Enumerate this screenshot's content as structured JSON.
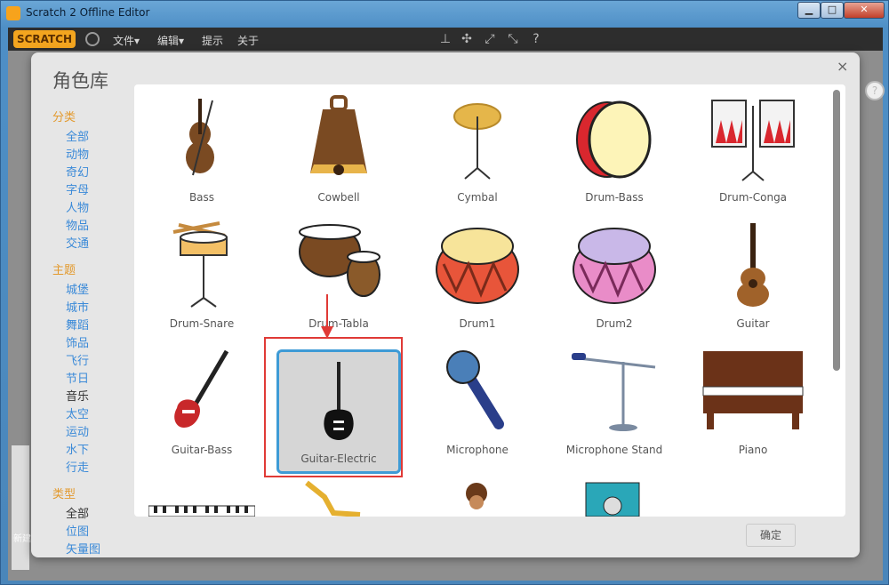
{
  "window": {
    "title": "Scratch 2 Offline Editor",
    "controls": {
      "minimize": "▁",
      "maximize": "□",
      "close": "✕"
    }
  },
  "menubar": {
    "logo": "SCRATCH",
    "items": [
      "文件▾",
      "编辑▾",
      "提示",
      "关于"
    ]
  },
  "dialog": {
    "title": "角色库",
    "close": "×",
    "ok_label": "确定",
    "sidebar": {
      "groups": [
        {
          "heading": "分类",
          "items": [
            "全部",
            "动物",
            "奇幻",
            "字母",
            "人物",
            "物品",
            "交通"
          ]
        },
        {
          "heading": "主题",
          "items": [
            "城堡",
            "城市",
            "舞蹈",
            "饰品",
            "飞行",
            "节日",
            "音乐",
            "太空",
            "运动",
            "水下",
            "行走"
          ]
        },
        {
          "heading": "类型",
          "items": [
            "全部",
            "位图",
            "矢量图"
          ]
        }
      ],
      "active": [
        "音乐",
        "全部"
      ]
    },
    "sprites": [
      {
        "label": "Bass",
        "icon": "bass-icon"
      },
      {
        "label": "Cowbell",
        "icon": "cowbell-icon"
      },
      {
        "label": "Cymbal",
        "icon": "cymbal-icon"
      },
      {
        "label": "Drum-Bass",
        "icon": "drum-bass-icon"
      },
      {
        "label": "Drum-Conga",
        "icon": "drum-conga-icon"
      },
      {
        "label": "Drum-Snare",
        "icon": "drum-snare-icon"
      },
      {
        "label": "Drum-Tabla",
        "icon": "drum-tabla-icon"
      },
      {
        "label": "Drum1",
        "icon": "drum1-icon"
      },
      {
        "label": "Drum2",
        "icon": "drum2-icon"
      },
      {
        "label": "Guitar",
        "icon": "guitar-icon"
      },
      {
        "label": "Guitar-Bass",
        "icon": "guitar-bass-icon"
      },
      {
        "label": "Guitar-Electric",
        "icon": "guitar-electric-icon",
        "selected": true
      },
      {
        "label": "Microphone",
        "icon": "microphone-icon"
      },
      {
        "label": "Microphone Stand",
        "icon": "microphone-stand-icon"
      },
      {
        "label": "Piano",
        "icon": "piano-icon"
      }
    ]
  },
  "left_panel": {
    "new_label": "新建"
  },
  "colors": {
    "accent": "#3e9bd6",
    "heading": "#e39a2e",
    "link": "#3b8ad8",
    "highlight": "#e03a36"
  }
}
